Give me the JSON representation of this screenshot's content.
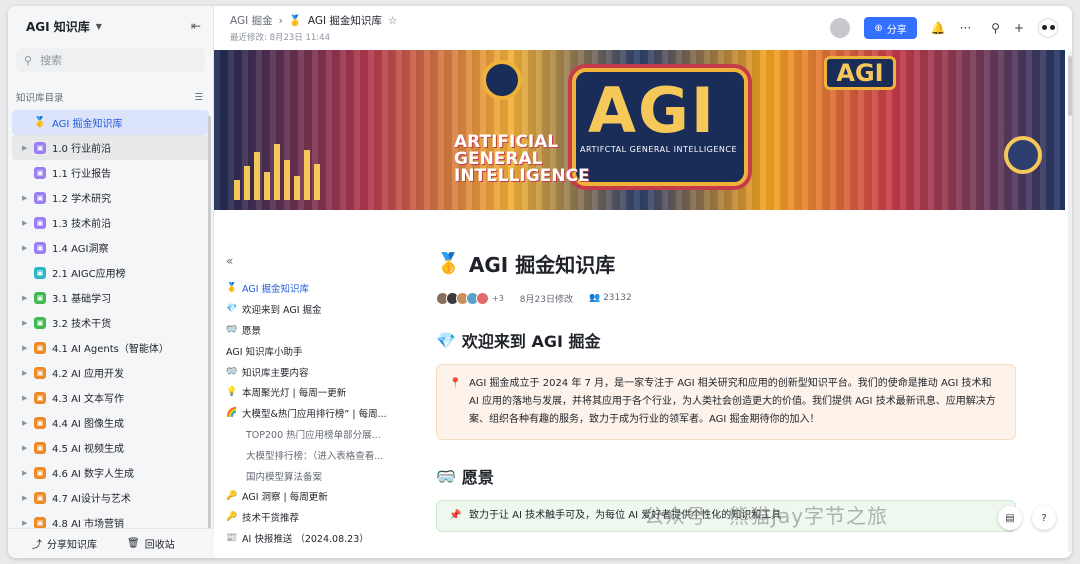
{
  "sidebar": {
    "title": "AGI 知识库",
    "search_placeholder": "搜索",
    "dir_label": "知识库目录",
    "items": [
      {
        "label": "AGI 掘金知识库",
        "icon": "🥇",
        "color": "#f5a623",
        "arrow": false
      },
      {
        "label": "1.0 行业前沿",
        "icon": "doc-icon",
        "color": "#9b7df5",
        "arrow": true
      },
      {
        "label": "1.1 行业报告",
        "icon": "doc-icon",
        "color": "#9b7df5",
        "arrow": false
      },
      {
        "label": "1.2 学术研究",
        "icon": "doc-icon",
        "color": "#9b7df5",
        "arrow": true
      },
      {
        "label": "1.3 技术前沿",
        "icon": "doc-icon",
        "color": "#9b7df5",
        "arrow": true
      },
      {
        "label": "1.4 AGI洞察",
        "icon": "doc-icon",
        "color": "#9b7df5",
        "arrow": true
      },
      {
        "label": "2.1 AIGC应用榜",
        "icon": "doc-icon",
        "color": "#2bb6c4",
        "arrow": false
      },
      {
        "label": "3.1 基础学习",
        "icon": "doc-icon",
        "color": "#3fb950",
        "arrow": true
      },
      {
        "label": "3.2 技术干货",
        "icon": "doc-icon",
        "color": "#3fb950",
        "arrow": true
      },
      {
        "label": "4.1 AI Agents（智能体）",
        "icon": "doc-icon",
        "color": "#f08a24",
        "arrow": true
      },
      {
        "label": "4.2 AI 应用开发",
        "icon": "doc-icon",
        "color": "#f08a24",
        "arrow": true
      },
      {
        "label": "4.3 AI 文本写作",
        "icon": "doc-icon",
        "color": "#f08a24",
        "arrow": true
      },
      {
        "label": "4.4 AI 图像生成",
        "icon": "doc-icon",
        "color": "#f08a24",
        "arrow": true
      },
      {
        "label": "4.5 AI 视频生成",
        "icon": "doc-icon",
        "color": "#f08a24",
        "arrow": true
      },
      {
        "label": "4.6 AI 数字人生成",
        "icon": "doc-icon",
        "color": "#f08a24",
        "arrow": true
      },
      {
        "label": "4.7 AI设计与艺术",
        "icon": "doc-icon",
        "color": "#f08a24",
        "arrow": true
      },
      {
        "label": "4.8 AI 市场营销",
        "icon": "doc-icon",
        "color": "#f08a24",
        "arrow": true
      }
    ],
    "footer": {
      "share": "分享知识库",
      "trash": "回收站"
    }
  },
  "topbar": {
    "breadcrumb_root": "AGI 掘金",
    "breadcrumb_current": "AGI 掘金知识库",
    "last_modified": "最近修改: 8月23日 11:44",
    "share_label": "分享"
  },
  "banner": {
    "big": "AGI",
    "subtitle": "ARTIFCTAL GENERAL INTELLIGENCE",
    "left_text": "ARTIFICIAL GENERAL INTELLIGENCE",
    "right_text": "AGI"
  },
  "toc": [
    {
      "icon": "🥇",
      "label": "AGI 掘金知识库",
      "level": 1,
      "active": true
    },
    {
      "icon": "💎",
      "label": "欢迎来到 AGI 掘金",
      "level": 1
    },
    {
      "icon": "🥽",
      "label": "愿景",
      "level": 1
    },
    {
      "icon": "",
      "label": "AGI 知识库小助手",
      "level": 1
    },
    {
      "icon": "🥽",
      "label": "知识库主要内容",
      "level": 1
    },
    {
      "icon": "💡",
      "label": "本周聚光灯 | 每周一更新",
      "level": 1
    },
    {
      "icon": "🌈",
      "label": "大模型&热门应用排行榜” | 每周...",
      "level": 1
    },
    {
      "icon": "",
      "label": "TOP200 热门应用榜单部分展...",
      "level": 2
    },
    {
      "icon": "",
      "label": "大模型排行榜：（进入表格查看...",
      "level": 2
    },
    {
      "icon": "",
      "label": "国内模型算法备案",
      "level": 2
    },
    {
      "icon": "🔑",
      "label": "AGI 洞察 | 每周更新",
      "level": 1
    },
    {
      "icon": "🔑",
      "label": "技术干货推荐",
      "level": 1
    },
    {
      "icon": "📰",
      "label": "AI 快报推送 （2024.08.23）",
      "level": 1
    }
  ],
  "doc": {
    "title": "AGI 掘金知识库",
    "title_icon": "🥇",
    "more_avatars": "+3",
    "modified": "8月23日修改",
    "views": "23132",
    "welcome_title": "欢迎来到 AGI 掘金",
    "welcome_icon": "💎",
    "welcome_text": "AGI 掘金成立于 2024 年 7 月，是一家专注于 AGI 相关研究和应用的创新型知识平台。我们的使命是推动 AGI 技术和 AI 应用的落地与发展，并将其应用于各个行业，为人类社会创造更大的价值。我们提供 AGI 技术最新讯息、应用解决方案、组织各种有趣的服务，致力于成为行业的领军者。AGI 掘金期待你的加入！",
    "vision_title": "愿景",
    "vision_icon": "🥽",
    "vision_text": "致力于让 AI 技术触手可及，为每位 AI 爱好者提供个性化的知识和工具"
  },
  "watermark": "公众号 · 熊猫Jay字节之旅"
}
